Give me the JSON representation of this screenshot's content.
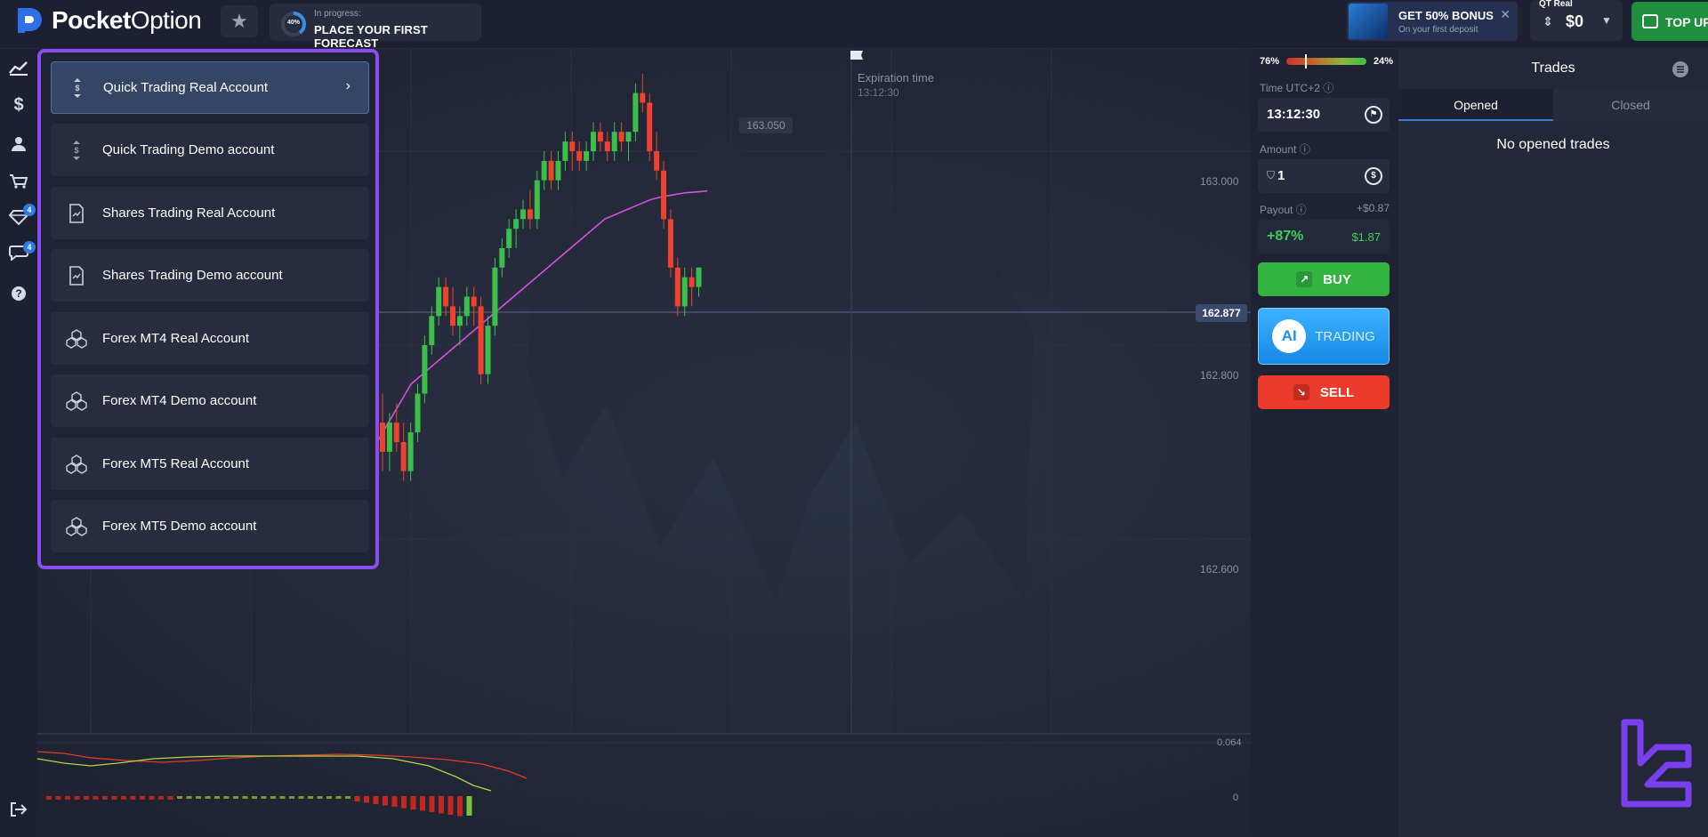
{
  "header": {
    "brand_bold": "Pocket",
    "brand_light": "Option",
    "progress": {
      "percent": "40%",
      "status": "In progress:",
      "title": "PLACE YOUR FIRST FORECAST"
    },
    "bonus": {
      "title": "GET 50% BONUS",
      "subtitle": "On your first deposit",
      "close": "✕"
    },
    "account": {
      "label": "QT Real",
      "balance": "$0",
      "caret": "▼"
    },
    "topup_label": "TOP UP"
  },
  "sidebar": {
    "badges": {
      "achievements": "4",
      "chat": "4"
    }
  },
  "account_menu": {
    "items": [
      {
        "label": "Quick Trading Real Account",
        "icon": "quick-trading-icon",
        "active": true
      },
      {
        "label": "Quick Trading Demo account",
        "icon": "quick-trading-icon",
        "active": false
      },
      {
        "label": "Shares Trading Real Account",
        "icon": "shares-document-icon",
        "active": false
      },
      {
        "label": "Shares Trading Demo account",
        "icon": "shares-document-icon",
        "active": false
      },
      {
        "label": "Forex MT4 Real Account",
        "icon": "forex-cubes-icon",
        "active": false
      },
      {
        "label": "Forex MT4 Demo account",
        "icon": "forex-cubes-icon",
        "active": false
      },
      {
        "label": "Forex MT5 Real Account",
        "icon": "forex-cubes-icon",
        "active": false
      },
      {
        "label": "Forex MT5 Demo account",
        "icon": "forex-cubes-icon",
        "active": false
      }
    ]
  },
  "chart": {
    "high_label": "163.050",
    "current_price": "162.877",
    "expiration_title": "Expiration time",
    "expiration_time": "13:12:30",
    "price_ticks": [
      "163.000",
      "162.800",
      "162.600"
    ],
    "indicator_ticks": [
      "0.064",
      "0"
    ]
  },
  "chart_data": {
    "type": "candlestick",
    "ohlc": [
      [
        162.72,
        162.75,
        162.67,
        162.69
      ],
      [
        162.69,
        162.73,
        162.67,
        162.72
      ],
      [
        162.72,
        162.74,
        162.69,
        162.7
      ],
      [
        162.7,
        162.72,
        162.66,
        162.67
      ],
      [
        162.67,
        162.72,
        162.66,
        162.71
      ],
      [
        162.71,
        162.76,
        162.7,
        162.75
      ],
      [
        162.75,
        162.81,
        162.74,
        162.8
      ],
      [
        162.8,
        162.84,
        162.79,
        162.83
      ],
      [
        162.83,
        162.87,
        162.82,
        162.86
      ],
      [
        162.86,
        162.87,
        162.83,
        162.84
      ],
      [
        162.84,
        162.86,
        162.81,
        162.82
      ],
      [
        162.82,
        162.84,
        162.8,
        162.83
      ],
      [
        162.83,
        162.86,
        162.82,
        162.85
      ],
      [
        162.85,
        162.86,
        162.82,
        162.84
      ],
      [
        162.84,
        162.85,
        162.76,
        162.77
      ],
      [
        162.77,
        162.83,
        162.76,
        162.82
      ],
      [
        162.82,
        162.89,
        162.81,
        162.88
      ],
      [
        162.88,
        162.91,
        162.87,
        162.9
      ],
      [
        162.9,
        162.93,
        162.89,
        162.92
      ],
      [
        162.92,
        162.94,
        162.9,
        162.93
      ],
      [
        162.93,
        162.95,
        162.92,
        162.94
      ],
      [
        162.94,
        162.96,
        162.92,
        162.93
      ],
      [
        162.93,
        162.98,
        162.92,
        162.97
      ],
      [
        162.97,
        163.0,
        162.96,
        162.99
      ],
      [
        162.99,
        163.0,
        162.96,
        162.97
      ],
      [
        162.97,
        163.0,
        162.96,
        162.99
      ],
      [
        162.99,
        163.02,
        162.98,
        163.01
      ],
      [
        163.01,
        163.02,
        162.98,
        163.0
      ],
      [
        163.0,
        163.01,
        162.98,
        162.99
      ],
      [
        162.99,
        163.01,
        162.98,
        163.0
      ],
      [
        163.0,
        163.03,
        162.99,
        163.02
      ],
      [
        163.02,
        163.03,
        163.0,
        163.01
      ],
      [
        163.01,
        163.02,
        162.99,
        163.0
      ],
      [
        163.0,
        163.03,
        162.99,
        163.02
      ],
      [
        163.02,
        163.03,
        163.0,
        163.01
      ],
      [
        163.01,
        163.02,
        162.99,
        163.02
      ],
      [
        163.02,
        163.07,
        163.01,
        163.06
      ],
      [
        163.06,
        163.08,
        163.04,
        163.05
      ],
      [
        163.05,
        163.06,
        162.99,
        163.0
      ],
      [
        163.0,
        163.02,
        162.97,
        162.98
      ],
      [
        162.98,
        162.99,
        162.92,
        162.93
      ],
      [
        162.93,
        162.94,
        162.87,
        162.88
      ],
      [
        162.88,
        162.89,
        162.83,
        162.84
      ],
      [
        162.84,
        162.88,
        162.83,
        162.87
      ],
      [
        162.87,
        162.88,
        162.84,
        162.86
      ],
      [
        162.86,
        162.88,
        162.85,
        162.88
      ]
    ],
    "moving_average": [
      162.58,
      162.6,
      162.62,
      162.64,
      162.66,
      162.68,
      162.7,
      162.72,
      162.74,
      162.76,
      162.77,
      162.78,
      162.79,
      162.8,
      162.81,
      162.82,
      162.83,
      162.84,
      162.85,
      162.86,
      162.87,
      162.88,
      162.89,
      162.9,
      162.91,
      162.92,
      162.93,
      162.935,
      162.94,
      162.945,
      162.95,
      162.953,
      162.955,
      162.957,
      162.958,
      162.959
    ]
  },
  "trade_panel": {
    "sentiment_left": "76%",
    "sentiment_right": "24%",
    "time_label": "Time UTC+2 ⓘ",
    "time_value": "13:12:30",
    "amount_label": "Amount ⓘ",
    "amount_value": "1",
    "payout_label": "Payout ⓘ",
    "payout_increment": "+$0.87",
    "payout_percent": "+87%",
    "payout_amount": "$1.87",
    "buy_label": "BUY",
    "ai_badge": "AI",
    "ai_label": "TRADING",
    "sell_label": "SELL"
  },
  "trades": {
    "title": "Trades",
    "tabs": [
      "Opened",
      "Closed"
    ],
    "empty_text": "No opened trades"
  },
  "colors": {
    "accent_purple": "#8a4df0",
    "buy_green": "#33b441",
    "sell_red": "#ea3b2c",
    "ai_blue": "#1f9bf5",
    "candle_up": "#3cbf4a",
    "candle_down": "#f0402e",
    "moving_average": "#d94fe0"
  }
}
